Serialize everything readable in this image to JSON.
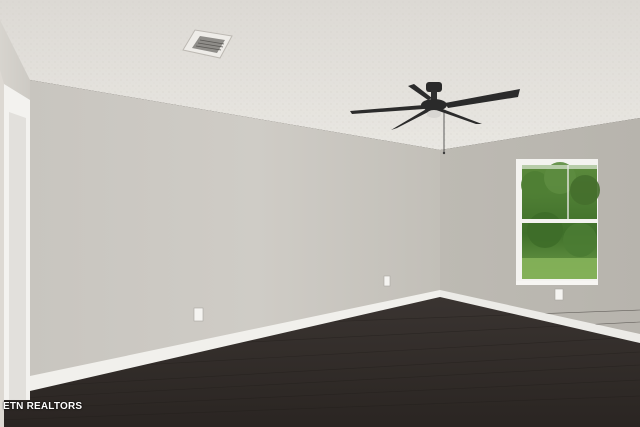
{
  "watermark": {
    "text": "ETN REALTORS"
  },
  "colors": {
    "ceiling": "#e4e1dc",
    "left_wall": "#cfccc6",
    "back_wall": "#c4c1bb",
    "right_wall": "#bdbbb4",
    "floor": "#2f2926",
    "baseboard": "#f2f1ee",
    "fan": "#2a2a2a"
  }
}
